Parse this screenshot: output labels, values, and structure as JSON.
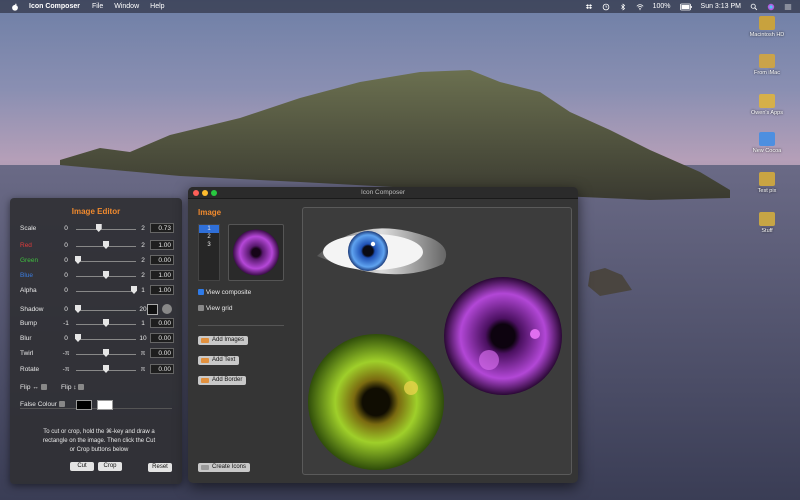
{
  "menubar": {
    "app_name": "Icon Composer",
    "menus": [
      "File",
      "Window",
      "Help"
    ],
    "battery": "100%",
    "clock": "Sun 3:13 PM"
  },
  "desktop_icons": [
    {
      "label": "Macintosh HD"
    },
    {
      "label": "From iMac"
    },
    {
      "label": "Owen's Apps"
    },
    {
      "label": "New Cocoa"
    },
    {
      "label": "Test pix"
    },
    {
      "label": "Stuff"
    }
  ],
  "editor": {
    "title": "Image Editor",
    "rows": [
      {
        "label": "Scale",
        "min": "0",
        "max": "2",
        "value": "0.73",
        "pos": 0.37,
        "label_color": "#e8e8e8"
      },
      {
        "label": "Red",
        "min": "0",
        "max": "2",
        "value": "1.00",
        "pos": 0.5,
        "label_color": "#e03b3b"
      },
      {
        "label": "Green",
        "min": "0",
        "max": "2",
        "value": "0.00",
        "pos": 0.0,
        "label_color": "#3fbf3f"
      },
      {
        "label": "Blue",
        "min": "0",
        "max": "2",
        "value": "1.00",
        "pos": 0.5,
        "label_color": "#3b7de0"
      },
      {
        "label": "Alpha",
        "min": "0",
        "max": "1",
        "value": "1.00",
        "pos": 1.0,
        "label_color": "#e8e8e8"
      },
      {
        "label": "Shadow",
        "min": "0",
        "max": "20",
        "value": "",
        "pos": 0.0,
        "label_color": "#e8e8e8"
      },
      {
        "label": "Bump",
        "min": "-1",
        "max": "1",
        "value": "0.00",
        "pos": 0.5,
        "label_color": "#e8e8e8"
      },
      {
        "label": "Blur",
        "min": "0",
        "max": "10",
        "value": "0.00",
        "pos": 0.0,
        "label_color": "#e8e8e8"
      },
      {
        "label": "Twirl",
        "min": "-π",
        "max": "π",
        "value": "0.00",
        "pos": 0.5,
        "label_color": "#e8e8e8"
      },
      {
        "label": "Rotate",
        "min": "-π",
        "max": "π",
        "value": "0.00",
        "pos": 0.5,
        "label_color": "#e8e8e8"
      }
    ],
    "flip_h": "Flip ↔",
    "flip_v": "Flip ↕",
    "false_colour": "False Colour",
    "instructions": "To cut or crop, hold the ⌘-key and draw a rectangle on the image.  Then click the Cut or Crop buttons below",
    "cut": "Cut",
    "crop": "Crop",
    "reset": "Reset"
  },
  "window": {
    "title": "Icon Composer",
    "section": "Image",
    "layers": [
      "1",
      "2",
      "3"
    ],
    "view_composite": "View composite",
    "view_grid": "View grid",
    "add_images": "Add Images",
    "add_text": "Add Text",
    "add_border": "Add Border",
    "create_icons": "Create Icons"
  },
  "colors": {
    "accent": "#f08a2e",
    "selection": "#2f6fd8"
  }
}
